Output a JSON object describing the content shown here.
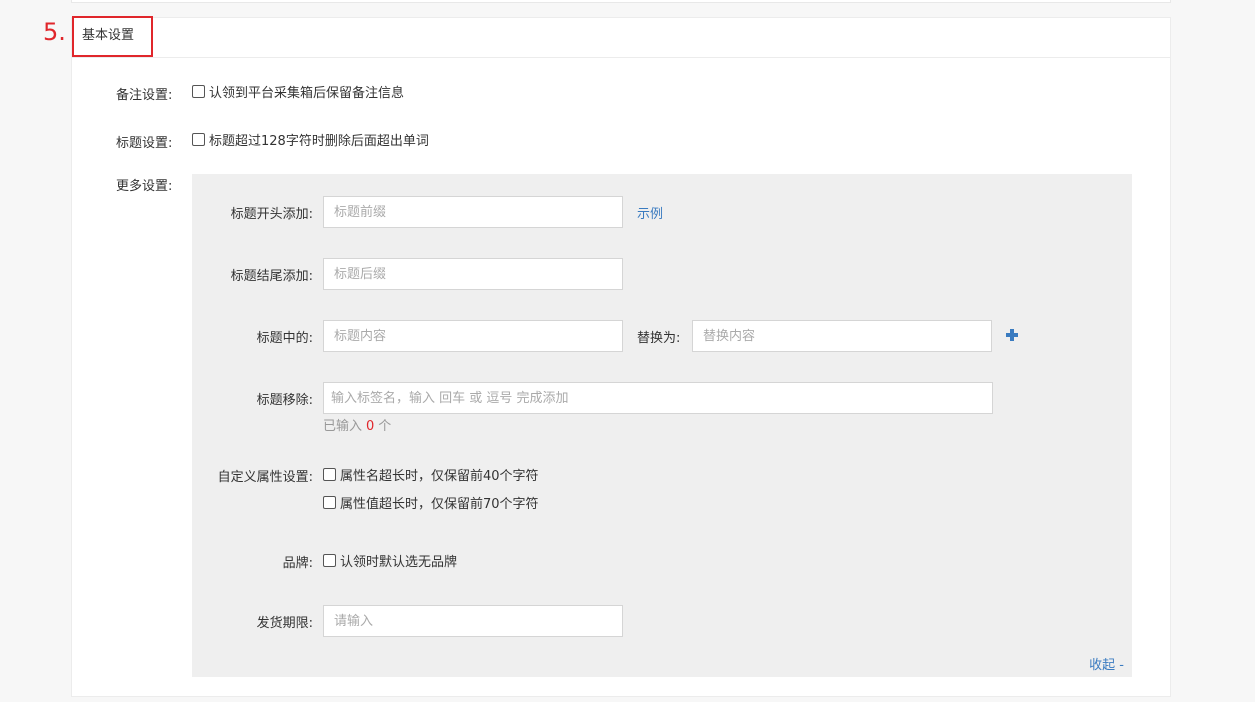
{
  "step_number": "5.",
  "section": {
    "title": "基本设置"
  },
  "remark_setting": {
    "label": "备注设置:",
    "checkbox_label": "认领到平台采集箱后保留备注信息"
  },
  "title_setting": {
    "label": "标题设置:",
    "checkbox_label": "标题超过128字符时删除后面超出单词"
  },
  "more_settings": {
    "label": "更多设置:",
    "prefix": {
      "label": "标题开头添加:",
      "placeholder": "标题前缀",
      "example_link": "示例"
    },
    "suffix": {
      "label": "标题结尾添加:",
      "placeholder": "标题后缀"
    },
    "replace": {
      "label": "标题中的:",
      "placeholder": "标题内容",
      "replace_label": "替换为:",
      "replace_placeholder": "替换内容"
    },
    "remove": {
      "label": "标题移除:",
      "placeholder": "输入标签名，输入 回车 或 逗号 完成添加",
      "hint_prefix": "已输入",
      "count": "0",
      "hint_suffix": "个"
    },
    "custom_attr": {
      "label": "自定义属性设置:",
      "name_checkbox": "属性名超长时，仅保留前40个字符",
      "value_checkbox": "属性值超长时，仅保留前70个字符"
    },
    "brand": {
      "label": "品牌:",
      "checkbox_label": "认领时默认选无品牌"
    },
    "delivery": {
      "label": "发货期限:",
      "placeholder": "请输入"
    },
    "collapse_link": "收起 -"
  }
}
